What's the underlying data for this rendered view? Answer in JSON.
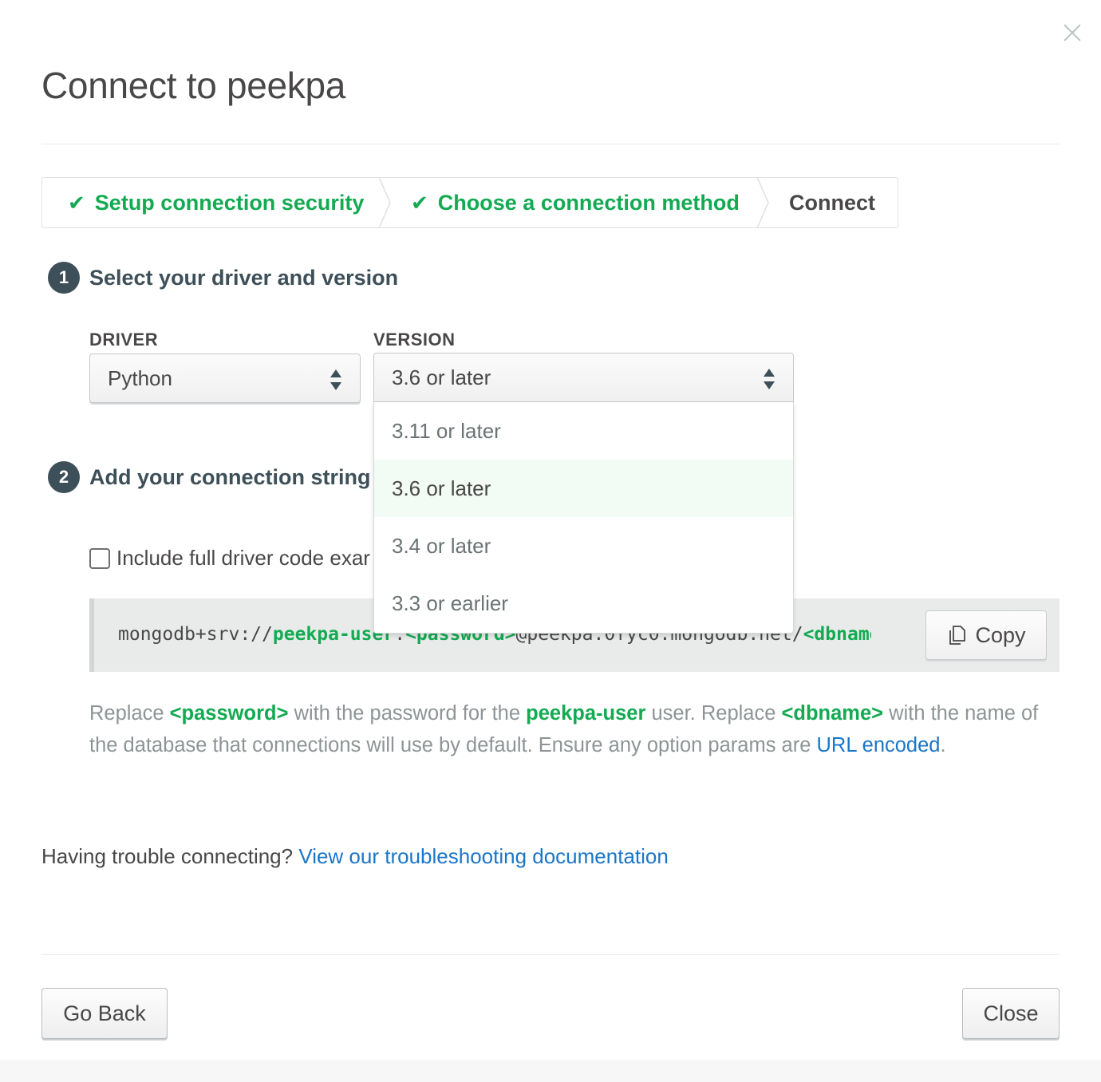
{
  "modal": {
    "title": "Connect to peekpa"
  },
  "steps": [
    {
      "label": "Setup connection security",
      "state": "done"
    },
    {
      "label": "Choose a connection method",
      "state": "done"
    },
    {
      "label": "Connect",
      "state": "current"
    }
  ],
  "section1": {
    "number": "1",
    "title": "Select your driver and version",
    "driver_label": "DRIVER",
    "driver_value": "Python",
    "version_label": "VERSION",
    "version_value": "3.6 or later",
    "version_options": [
      "3.11 or later",
      "3.6 or later",
      "3.4 or later",
      "3.3 or earlier"
    ],
    "version_selected_index": 1
  },
  "section2": {
    "number": "2",
    "title_visible": "Add your connection string i",
    "checkbox_label_visible": "Include full driver code exar",
    "checkbox_checked": false,
    "connection": {
      "prefix": "mongodb+srv://",
      "user": "peekpa-user",
      "sep": ":",
      "password": "<password>",
      "host": "@peekpa.0fyc0.mongodb.net/",
      "dbname": "<dbname>"
    },
    "copy_label": "Copy"
  },
  "help": {
    "t1": "Replace ",
    "password": "<password>",
    "t2": " with the password for the ",
    "user": "peekpa-user",
    "t3": " user. Replace ",
    "dbname": "<dbname>",
    "t4": " with the name of the database that connections will use by default. Ensure any option params are ",
    "link": "URL encoded",
    "t5": "."
  },
  "trouble": {
    "text": "Having trouble connecting? ",
    "link": "View our troubleshooting documentation"
  },
  "footer": {
    "back": "Go Back",
    "close": "Close"
  },
  "colors": {
    "accent_green": "#13aa52",
    "link_blue": "#1a76c8",
    "selected_option_bg": "#f2fbf4"
  }
}
